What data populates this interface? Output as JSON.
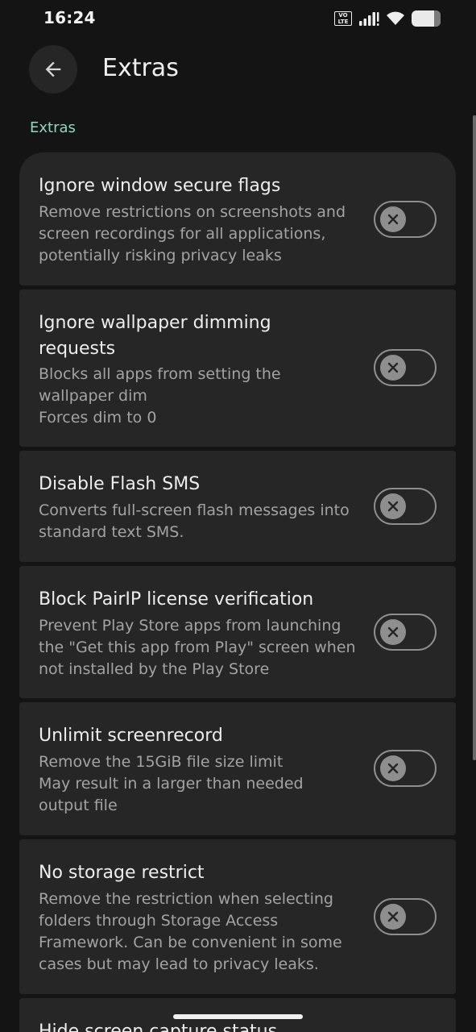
{
  "status_bar": {
    "time": "16:24",
    "volte_top": "VO",
    "volte_bottom": "LTE"
  },
  "app_bar": {
    "title": "Extras",
    "back_icon": "arrow-back-icon"
  },
  "section": {
    "header": "Extras"
  },
  "settings": [
    {
      "title": "Ignore window secure flags",
      "description": "Remove restrictions on screenshots and screen recordings for all applications, potentially risking privacy leaks",
      "enabled": false
    },
    {
      "title": "Ignore wallpaper dimming requests",
      "description": "Blocks all apps from setting the wallpaper dim\nForces dim to 0",
      "enabled": false
    },
    {
      "title": "Disable Flash SMS",
      "description": "Converts full-screen flash messages into standard text SMS.",
      "enabled": false
    },
    {
      "title": "Block PairIP license verification",
      "description": "Prevent Play Store apps from launching the \"Get this app from Play\" screen when not installed by the Play Store",
      "enabled": false
    },
    {
      "title": "Unlimit screenrecord",
      "description": "Remove the 15GiB file size limit\nMay result in a larger than needed output file",
      "enabled": false
    },
    {
      "title": "No storage restrict",
      "description": "Remove the restriction when selecting folders through Storage Access Framework. Can be convenient in some cases but may lead to privacy leaks.",
      "enabled": false
    },
    {
      "title": "Hide screen capture status",
      "description": "",
      "enabled": false
    }
  ],
  "colors": {
    "background": "#141414",
    "card": "#262626",
    "accent": "#8fd6c4",
    "toggle_off": "#8e8e8e"
  }
}
